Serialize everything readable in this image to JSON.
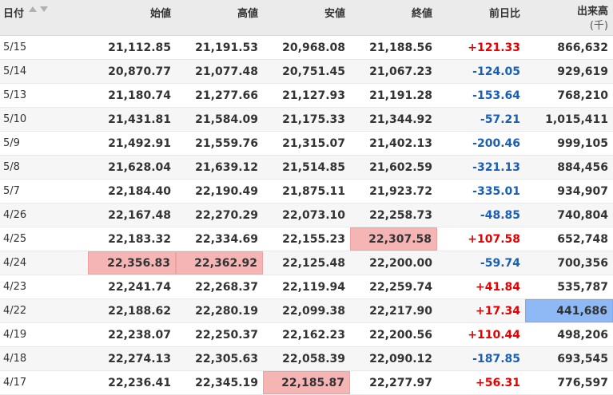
{
  "header": {
    "date": "日付",
    "open": "始値",
    "high": "高値",
    "low": "安値",
    "close": "終値",
    "change": "前日比",
    "volume": "出来高",
    "volume_unit": "(千)"
  },
  "icons": {
    "sort_asc": "sort-asc-icon",
    "sort_desc": "sort-desc-icon"
  },
  "colors": {
    "positive": "#e60000",
    "negative": "#1a5fb4",
    "highlight_red": "#f6b5b5",
    "highlight_blue": "#8fb9f4"
  },
  "rows": [
    {
      "date": "5/15",
      "open": "21,112.85",
      "high": "21,191.53",
      "low": "20,968.08",
      "close": "21,188.56",
      "change": "+121.33",
      "volume": "866,632",
      "sign": "pos",
      "hl": {}
    },
    {
      "date": "5/14",
      "open": "20,870.77",
      "high": "21,077.48",
      "low": "20,751.45",
      "close": "21,067.23",
      "change": "-124.05",
      "volume": "929,619",
      "sign": "neg",
      "hl": {}
    },
    {
      "date": "5/13",
      "open": "21,180.74",
      "high": "21,277.66",
      "low": "21,127.93",
      "close": "21,191.28",
      "change": "-153.64",
      "volume": "768,210",
      "sign": "neg",
      "hl": {}
    },
    {
      "date": "5/10",
      "open": "21,431.81",
      "high": "21,584.09",
      "low": "21,175.33",
      "close": "21,344.92",
      "change": "-57.21",
      "volume": "1,015,411",
      "sign": "neg",
      "hl": {}
    },
    {
      "date": "5/9",
      "open": "21,492.91",
      "high": "21,559.76",
      "low": "21,315.07",
      "close": "21,402.13",
      "change": "-200.46",
      "volume": "999,105",
      "sign": "neg",
      "hl": {}
    },
    {
      "date": "5/8",
      "open": "21,628.04",
      "high": "21,639.12",
      "low": "21,514.85",
      "close": "21,602.59",
      "change": "-321.13",
      "volume": "884,456",
      "sign": "neg",
      "hl": {}
    },
    {
      "date": "5/7",
      "open": "22,184.40",
      "high": "22,190.49",
      "low": "21,875.11",
      "close": "21,923.72",
      "change": "-335.01",
      "volume": "934,907",
      "sign": "neg",
      "hl": {}
    },
    {
      "date": "4/26",
      "open": "22,167.48",
      "high": "22,270.29",
      "low": "22,073.10",
      "close": "22,258.73",
      "change": "-48.85",
      "volume": "740,804",
      "sign": "neg",
      "hl": {}
    },
    {
      "date": "4/25",
      "open": "22,183.32",
      "high": "22,334.69",
      "low": "22,155.23",
      "close": "22,307.58",
      "change": "+107.58",
      "volume": "652,748",
      "sign": "pos",
      "hl": {
        "close": "red"
      }
    },
    {
      "date": "4/24",
      "open": "22,356.83",
      "high": "22,362.92",
      "low": "22,125.48",
      "close": "22,200.00",
      "change": "-59.74",
      "volume": "700,356",
      "sign": "neg",
      "hl": {
        "open": "red",
        "high": "red"
      }
    },
    {
      "date": "4/23",
      "open": "22,241.74",
      "high": "22,268.37",
      "low": "22,119.94",
      "close": "22,259.74",
      "change": "+41.84",
      "volume": "535,787",
      "sign": "pos",
      "hl": {}
    },
    {
      "date": "4/22",
      "open": "22,188.62",
      "high": "22,280.19",
      "low": "22,099.38",
      "close": "22,217.90",
      "change": "+17.34",
      "volume": "441,686",
      "sign": "pos",
      "hl": {
        "volume": "blue"
      }
    },
    {
      "date": "4/19",
      "open": "22,238.07",
      "high": "22,250.37",
      "low": "22,162.23",
      "close": "22,200.56",
      "change": "+110.44",
      "volume": "498,206",
      "sign": "pos",
      "hl": {}
    },
    {
      "date": "4/18",
      "open": "22,274.13",
      "high": "22,305.63",
      "low": "22,058.39",
      "close": "22,090.12",
      "change": "-187.85",
      "volume": "693,545",
      "sign": "neg",
      "hl": {}
    },
    {
      "date": "4/17",
      "open": "22,236.41",
      "high": "22,345.19",
      "low": "22,185.87",
      "close": "22,277.97",
      "change": "+56.31",
      "volume": "776,597",
      "sign": "pos",
      "hl": {
        "low": "red"
      }
    }
  ]
}
